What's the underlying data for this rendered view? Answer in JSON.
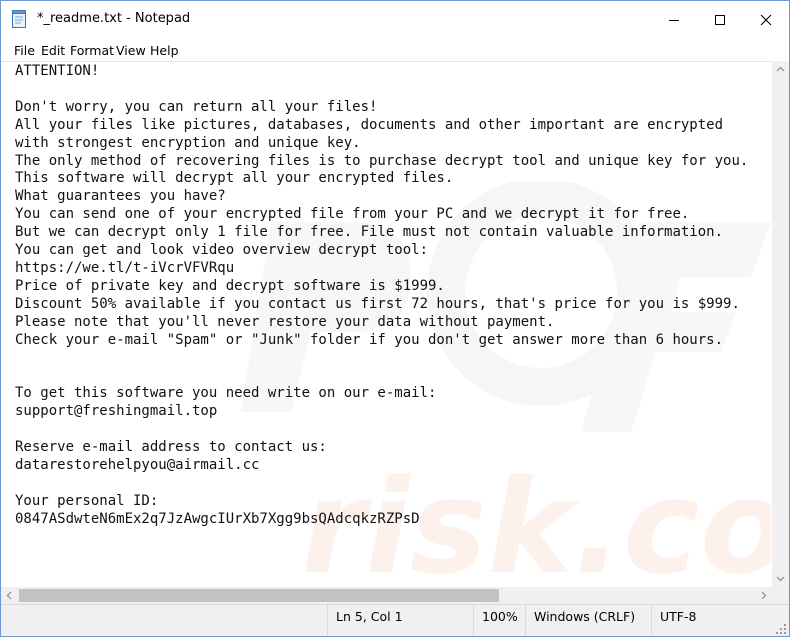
{
  "window": {
    "title": "*_readme.txt - Notepad"
  },
  "menu": [
    "File",
    "Edit",
    "Format",
    "View",
    "Help"
  ],
  "document": {
    "lines": [
      "ATTENTION!",
      "",
      "Don't worry, you can return all your files!",
      "All your files like pictures, databases, documents and other important are encrypted",
      "with strongest encryption and unique key.",
      "The only method of recovering files is to purchase decrypt tool and unique key for you.",
      "This software will decrypt all your encrypted files.",
      "What guarantees you have?",
      "You can send one of your encrypted file from your PC and we decrypt it for free.",
      "But we can decrypt only 1 file for free. File must not contain valuable information.",
      "You can get and look video overview decrypt tool:",
      "https://we.tl/t-iVcrVFVRqu",
      "Price of private key and decrypt software is $1999.",
      "Discount 50% available if you contact us first 72 hours, that's price for you is $999.",
      "Please note that you'll never restore your data without payment.",
      "Check your e-mail \"Spam\" or \"Junk\" folder if you don't get answer more than 6 hours.",
      "",
      "",
      "To get this software you need write on our e-mail:",
      "support@freshingmail.top",
      "",
      "Reserve e-mail address to contact us:",
      "datarestorehelpyou@airmail.cc",
      "",
      "Your personal ID:",
      "0847ASdwteN6mEx2q7JzAwgcIUrXb7Xgg9bsQAdcqkzRZPsD"
    ]
  },
  "status": {
    "position": "Ln 5, Col 1",
    "zoom": "100%",
    "line_ending": "Windows (CRLF)",
    "encoding": "UTF-8"
  },
  "icons": {
    "app": "notepad-icon",
    "minimize": "minimize-icon",
    "maximize": "maximize-icon",
    "close": "close-icon"
  }
}
